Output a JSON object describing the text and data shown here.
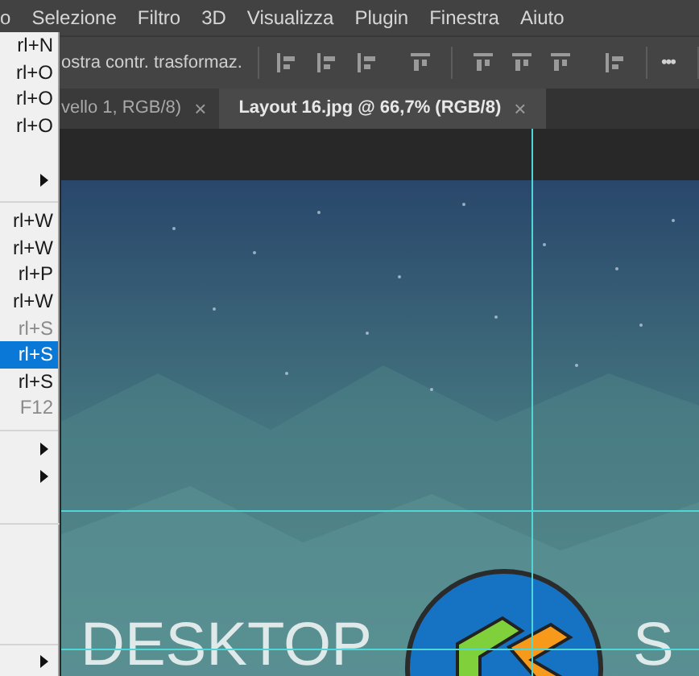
{
  "menubar": [
    "o",
    "Selezione",
    "Filtro",
    "3D",
    "Visualizza",
    "Plugin",
    "Finestra",
    "Aiuto"
  ],
  "options_bar": {
    "label": "ostra contr. trasformaz.",
    "more": "•••"
  },
  "tabs": [
    {
      "label": "vello 1, RGB/8)",
      "close": "×",
      "selected": false
    },
    {
      "label": "Layout 16.jpg @ 66,7% (RGB/8)",
      "close": "×",
      "selected": true
    }
  ],
  "file_menu": {
    "sections": [
      [
        {
          "kind": "item",
          "shortcut": "rl+N",
          "disabled": false,
          "selected": false
        },
        {
          "kind": "item",
          "shortcut": "rl+O",
          "disabled": false,
          "selected": false
        },
        {
          "kind": "item",
          "shortcut": "rl+O",
          "disabled": false,
          "selected": false
        },
        {
          "kind": "item",
          "shortcut": "rl+O",
          "disabled": false,
          "selected": false
        },
        {
          "kind": "submenu"
        }
      ],
      [
        {
          "kind": "item",
          "shortcut": "rl+W",
          "disabled": false,
          "selected": false
        },
        {
          "kind": "item",
          "shortcut": "rl+W",
          "disabled": false,
          "selected": false
        },
        {
          "kind": "item",
          "shortcut": "rl+P",
          "disabled": false,
          "selected": false
        },
        {
          "kind": "item",
          "shortcut": "rl+W",
          "disabled": false,
          "selected": false
        },
        {
          "kind": "item",
          "shortcut": "rl+S",
          "disabled": true,
          "selected": false
        },
        {
          "kind": "item",
          "shortcut": "rl+S",
          "disabled": false,
          "selected": true
        },
        {
          "kind": "item",
          "shortcut": "rl+S",
          "disabled": false,
          "selected": false
        },
        {
          "kind": "item",
          "shortcut": "F12",
          "disabled": true,
          "selected": false
        }
      ],
      [
        {
          "kind": "submenu"
        },
        {
          "kind": "submenu"
        }
      ],
      [
        {
          "kind": "submenu"
        }
      ]
    ]
  },
  "canvas": {
    "title_left": "DESKTOP",
    "title_right": "S"
  }
}
